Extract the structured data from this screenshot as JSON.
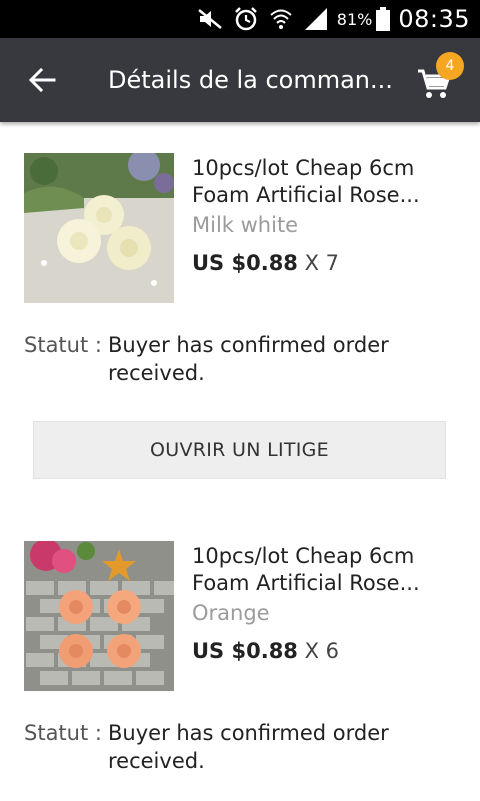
{
  "statusbar": {
    "battery_percent": "81%",
    "time": "08:35",
    "icons": [
      "mute-icon",
      "alarm-icon",
      "wifi-icon",
      "signal-icon",
      "battery-icon"
    ]
  },
  "appbar": {
    "title": "Détails de la comman...",
    "cart_count": "4",
    "colors": {
      "bar": "#37393e",
      "badge": "#f5a623"
    }
  },
  "orders": [
    {
      "title": "10pcs/lot Cheap 6cm Foam Artificial Rose...",
      "variant": "Milk white",
      "price": "US $0.88",
      "quantity": "X 7",
      "status_label": "Statut :",
      "status_value": "Buyer has confirmed order received.",
      "image_desc": "white-foam-roses-photo"
    },
    {
      "title": "10pcs/lot Cheap 6cm Foam Artificial Rose...",
      "variant": "Orange",
      "price": "US $0.88",
      "quantity": "X 6",
      "status_label": "Statut :",
      "status_value": "Buyer has confirmed order received.",
      "image_desc": "orange-foam-roses-photo"
    }
  ],
  "dispute_button": {
    "label": "OUVRIR UN LITIGE"
  }
}
